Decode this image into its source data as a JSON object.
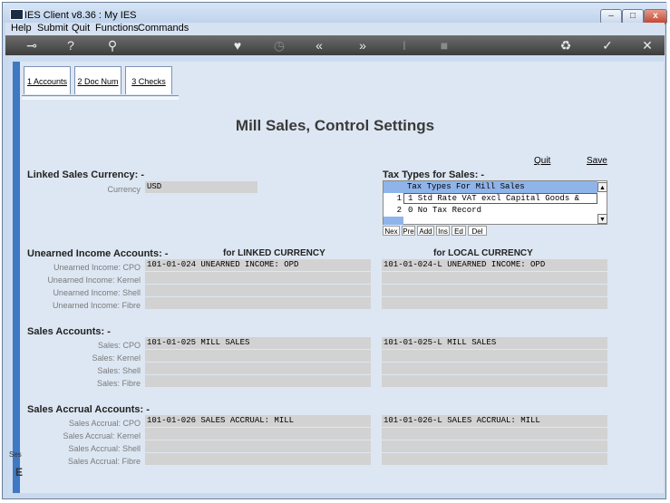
{
  "window": {
    "title": "IES Client v8.36 : My IES",
    "minimize": "–",
    "maximize": "□",
    "close": "x"
  },
  "menu": [
    "Help",
    "Submit",
    "Quit",
    "Functions",
    "Commands"
  ],
  "toolbar_icons": [
    "key-icon",
    "help-icon",
    "search-icon",
    "heart-icon",
    "clock-icon",
    "rewind-icon",
    "forward-icon",
    "text-cursor-icon",
    "square-icon",
    "recycle-icon",
    "check-icon",
    "close-icon"
  ],
  "tabs": [
    {
      "label": "1 Accounts"
    },
    {
      "label": "2 Doc Num"
    },
    {
      "label": "3 Checks"
    }
  ],
  "page_title": "Mill Sales, Control Settings",
  "actions": {
    "quit": "Quit",
    "save": "Save"
  },
  "linked_sales_currency": {
    "title": "Linked Sales Currency: -",
    "currency_label": "Currency",
    "currency_value": "USD"
  },
  "tax_types": {
    "title": "Tax Types for Sales: -",
    "list_header": "Tax Types For Mill Sales",
    "rows": [
      {
        "num": "1",
        "text": "1 Std Rate VAT excl Capital Goods &"
      },
      {
        "num": "2",
        "text": "0 No Tax Record"
      }
    ],
    "buttons": [
      "Nex",
      "Pre",
      "Add",
      "Ins",
      "Ed",
      "Del"
    ]
  },
  "column_headers": {
    "linked": "for LINKED CURRENCY",
    "local": "for LOCAL CURRENCY"
  },
  "unearned_income": {
    "title": "Unearned Income Accounts: -",
    "rows": [
      {
        "label": "Unearned Income: CPO",
        "linked": "101-01-024 UNEARNED INCOME: OPD",
        "local": "101-01-024-L UNEARNED INCOME: OPD"
      },
      {
        "label": "Unearned Income: Kernel",
        "linked": "",
        "local": ""
      },
      {
        "label": "Unearned Income: Shell",
        "linked": "",
        "local": ""
      },
      {
        "label": "Unearned Income: Fibre",
        "linked": "",
        "local": ""
      }
    ]
  },
  "sales_accounts": {
    "title": "Sales Accounts: -",
    "rows": [
      {
        "label": "Sales: CPO",
        "linked": "101-01-025 MILL SALES",
        "local": "101-01-025-L MILL SALES"
      },
      {
        "label": "Sales: Kernel",
        "linked": "",
        "local": ""
      },
      {
        "label": "Sales: Shell",
        "linked": "",
        "local": ""
      },
      {
        "label": "Sales: Fibre",
        "linked": "",
        "local": ""
      }
    ]
  },
  "sales_accrual": {
    "title": "Sales Accrual Accounts: -",
    "rows": [
      {
        "label": "Sales Accrual: CPO",
        "linked": "101-01-026 SALES ACCRUAL: MILL",
        "local": "101-01-026-L SALES ACCRUAL: MILL"
      },
      {
        "label": "Sales Accrual: Kernel",
        "linked": "",
        "local": ""
      },
      {
        "label": "Sales Accrual: Shell",
        "linked": "",
        "local": ""
      },
      {
        "label": "Sales Accrual: Fibre",
        "linked": "",
        "local": ""
      }
    ]
  },
  "edge_text": {
    "a": "Ses",
    "b": "E"
  }
}
